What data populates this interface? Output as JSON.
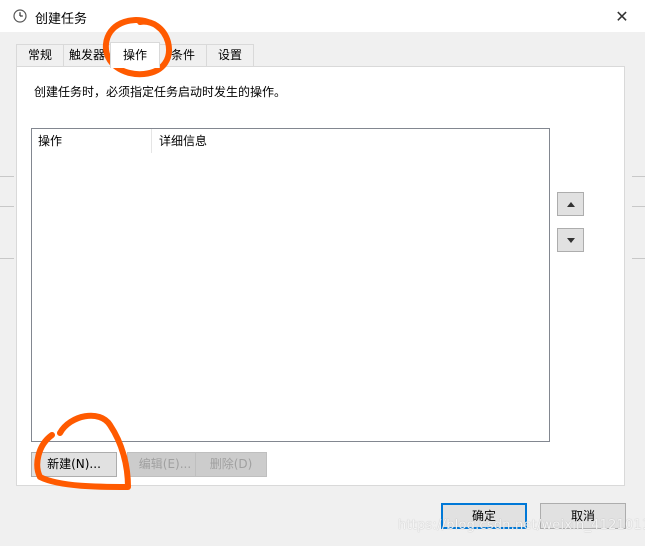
{
  "window": {
    "title": "创建任务",
    "close_glyph": "✕"
  },
  "tabs": [
    {
      "label": "常规",
      "active": false
    },
    {
      "label": "触发器",
      "active": false
    },
    {
      "label": "操作",
      "active": true
    },
    {
      "label": "条件",
      "active": false
    },
    {
      "label": "设置",
      "active": false
    }
  ],
  "panel": {
    "description": "创建任务时，必须指定任务启动时发生的操作。",
    "list_columns": [
      "操作",
      "详细信息"
    ]
  },
  "buttons": {
    "new": "新建(N)...",
    "edit": "编辑(E)...",
    "delete": "删除(D)",
    "ok": "确定",
    "cancel": "取消"
  },
  "watermark": "https://blog.csdn.net/weixin_41210113",
  "colors": {
    "annotation": "#ff5a00",
    "accent": "#0078d7"
  },
  "icons": {
    "title": "clock-icon",
    "move_up": "triangle-up-icon",
    "move_down": "triangle-down-icon"
  }
}
